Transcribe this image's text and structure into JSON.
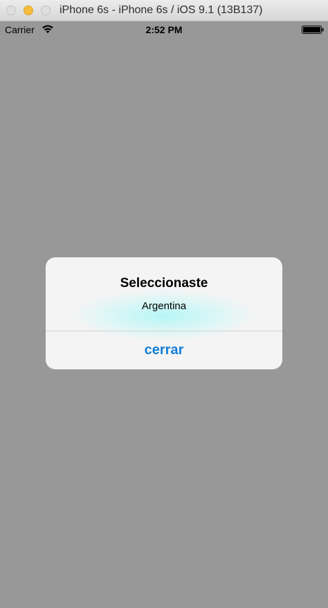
{
  "window": {
    "title": "iPhone 6s - iPhone 6s / iOS 9.1 (13B137)",
    "controls": [
      "close-icon",
      "minimize-icon",
      "zoom-icon"
    ]
  },
  "status_bar": {
    "carrier": "Carrier",
    "time": "2:52 PM",
    "icons": [
      "wifi-icon",
      "battery-icon"
    ]
  },
  "alert": {
    "title": "Seleccionaste",
    "message": "Argentina",
    "button_label": "cerrar",
    "button_color": "#147fd8"
  },
  "colors": {
    "dimmed_background": "#989898",
    "alert_background": "#f4f4f4"
  }
}
